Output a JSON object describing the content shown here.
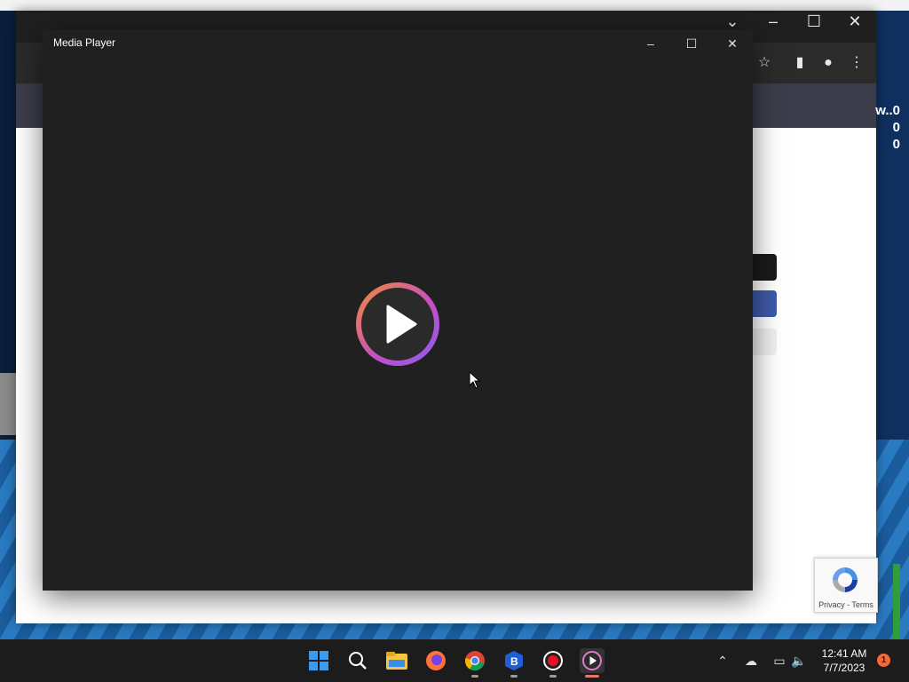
{
  "media_player": {
    "title": "Media Player",
    "play_icon": "play-icon",
    "play_ring_colors": [
      "#f08a3c",
      "#c94fc0",
      "#8a5cf0"
    ]
  },
  "browser": {
    "stats": [
      "w..0",
      "0",
      "0"
    ],
    "recaptcha": {
      "text": "Privacy - Terms"
    }
  },
  "taskbar": {
    "apps": [
      "start",
      "search",
      "file-explorer",
      "firefox",
      "chrome",
      "app-b",
      "recorder",
      "media-player"
    ],
    "clock": {
      "time": "12:41 AM",
      "date": "7/7/2023"
    },
    "notification_count": "1"
  },
  "colors": {
    "accent_green": "#2e9d3a",
    "player_bg": "#202020",
    "taskbar_bg": "#1c1c1c"
  }
}
